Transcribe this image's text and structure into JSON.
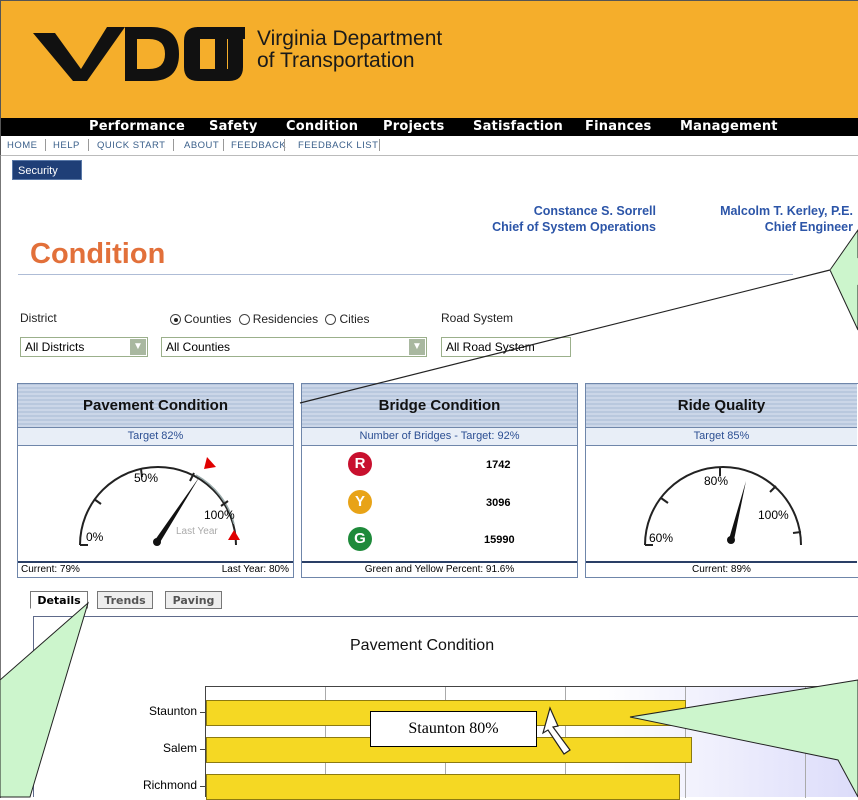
{
  "header": {
    "logo_mark": "VDOT",
    "org_line1": "Virginia Department",
    "org_line2": "of Transportation",
    "bg_color": "#f5ae2b"
  },
  "main_nav": [
    "Performance",
    "Safety",
    "Condition",
    "Projects",
    "Satisfaction",
    "Finances",
    "Management"
  ],
  "sub_nav": [
    "HOME",
    "HELP",
    "QUICK START",
    "ABOUT",
    "FEEDBACK",
    "FEEDBACK LIST"
  ],
  "security_button": "Security",
  "people": [
    {
      "name": "Constance S. Sorrell",
      "role": "Chief of System Operations"
    },
    {
      "name": "Malcolm T. Kerley, P.E.",
      "role": "Chief Engineer"
    }
  ],
  "page_title": "Condition",
  "filters": {
    "district_label": "District",
    "district_value": "All Districts",
    "radios": [
      {
        "label": "Counties",
        "selected": true
      },
      {
        "label": "Residencies",
        "selected": false
      },
      {
        "label": "Cities",
        "selected": false
      }
    ],
    "county_value": "All Counties",
    "road_system_label": "Road System",
    "road_system_value": "All Road System"
  },
  "panels": {
    "pavement": {
      "title": "Pavement Condition",
      "target": "Target 82%",
      "gauge_labels": [
        "50%",
        "100%",
        "0%"
      ],
      "last_year_marker": "Last Year",
      "current": "Current: 79%",
      "last_year": "Last Year: 80%",
      "current_value": 79,
      "last_year_value": 80
    },
    "bridge": {
      "title": "Bridge Condition",
      "target": "Number of Bridges - Target: 92%",
      "rows": [
        {
          "letter": "R",
          "color": "#c8102e",
          "count": "1742"
        },
        {
          "letter": "Y",
          "color": "#e8a317",
          "count": "3096"
        },
        {
          "letter": "G",
          "color": "#1e8a3a",
          "count": "15990"
        }
      ],
      "footer": "Green and Yellow Percent: 91.6%"
    },
    "ride": {
      "title": "Ride Quality",
      "target": "Target 85%",
      "gauge_labels": [
        "80%",
        "100%",
        "60%"
      ],
      "current": "Current: 89%",
      "current_value": 89
    }
  },
  "tabs": [
    "Details",
    "Trends",
    "Paving"
  ],
  "active_tab": "Details",
  "chart_data": {
    "type": "bar",
    "orientation": "horizontal",
    "title": "Pavement Condition",
    "categories": [
      "Staunton",
      "Salem",
      "Richmond"
    ],
    "values": [
      80,
      81,
      79
    ],
    "xlim": [
      0,
      100
    ],
    "bar_color": "#f5d823"
  },
  "callout": "Staunton 80%"
}
